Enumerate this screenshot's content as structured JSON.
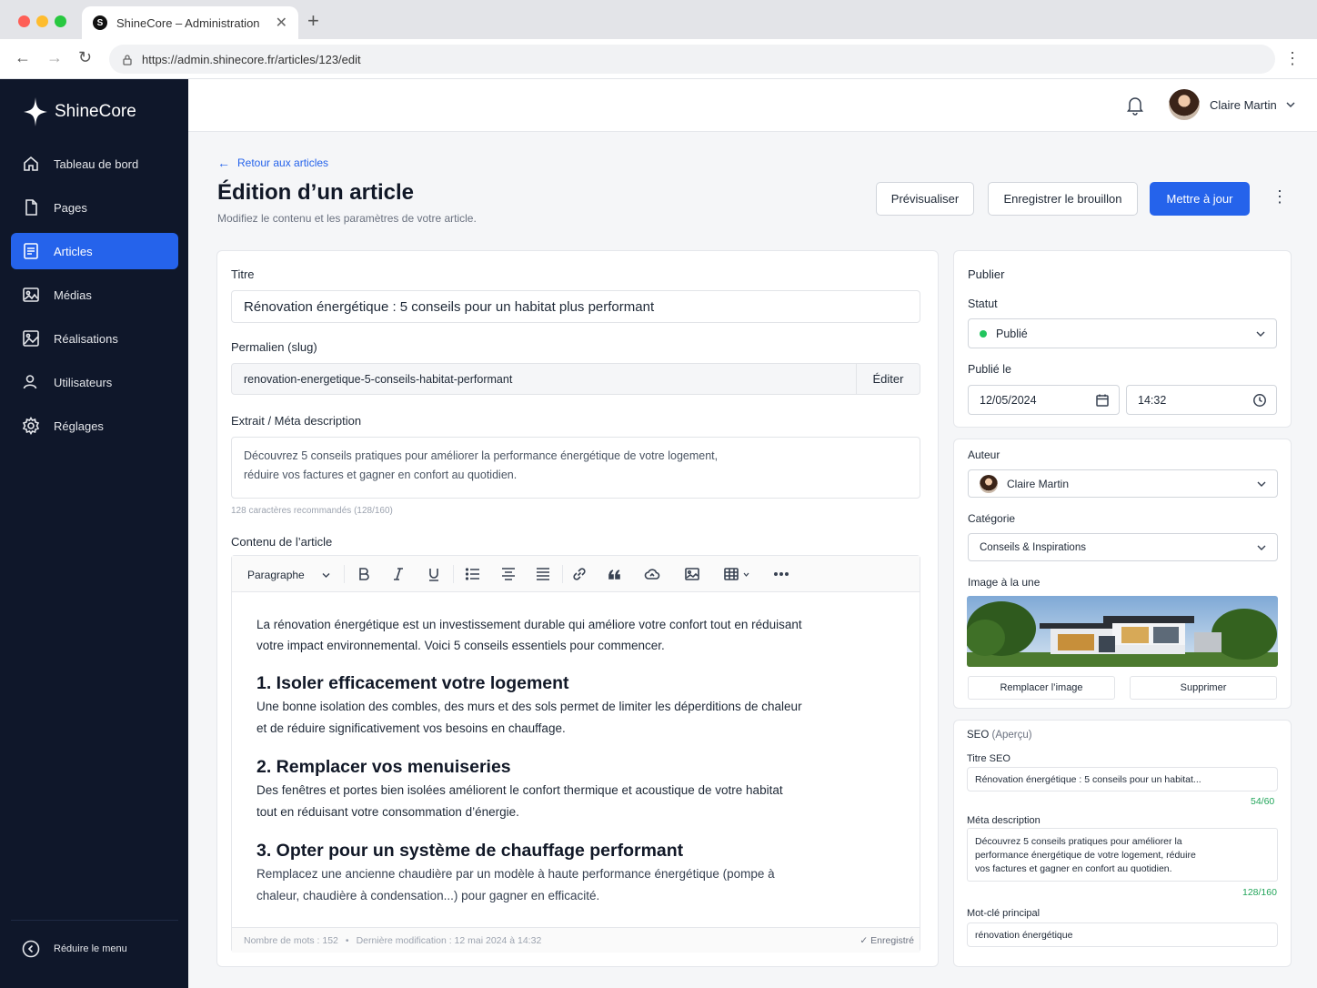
{
  "browser": {
    "tab_title": "ShineCore – Administration",
    "tab_close": "✕",
    "new_tab": "+",
    "url": "https://admin.shinecore.fr/articles/123/edit"
  },
  "sidebar": {
    "brand": "ShineCore",
    "items": [
      {
        "label": "Tableau de bord",
        "icon": "home-icon"
      },
      {
        "label": "Pages",
        "icon": "file-icon"
      },
      {
        "label": "Articles",
        "icon": "article-icon",
        "active": true
      },
      {
        "label": "Médias",
        "icon": "image-icon"
      },
      {
        "label": "Réalisations",
        "icon": "gallery-icon"
      },
      {
        "label": "Utilisateurs",
        "icon": "user-icon"
      },
      {
        "label": "Réglages",
        "icon": "gear-icon"
      }
    ],
    "collapse_label": "Réduire le menu"
  },
  "topbar": {
    "user_name": "Claire Martin"
  },
  "header": {
    "back_label": "Retour aux articles",
    "title": "Édition d’un article",
    "subtitle": "Modifiez le contenu et les paramètres de votre article.",
    "preview_label": "Prévisualiser",
    "draft_label": "Enregistrer le brouillon",
    "update_label": "Mettre à jour"
  },
  "form": {
    "title_label": "Titre",
    "title_value": "Rénovation énergétique : 5 conseils pour un habitat plus performant",
    "slug_label": "Permalien (slug)",
    "slug_value": "renovation-energetique-5-conseils-habitat-performant",
    "slug_edit": "Éditer",
    "excerpt_label": "Extrait / Méta description",
    "excerpt_line1": "Découvrez 5 conseils pratiques pour améliorer la performance énergétique de votre logement,",
    "excerpt_line2": "réduire vos factures et gagner en confort au quotidien.",
    "excerpt_hint": "128 caractères recommandés (128/160)",
    "content_label": "Contenu de l’article"
  },
  "editor": {
    "paragraph_select": "Paragraphe",
    "intro": "La rénovation énergétique est un investissement durable qui améliore votre confort tout en réduisant votre impact environnemental. Voici 5 conseils essentiels pour commencer.",
    "sections": [
      {
        "heading": "1. Isoler efficacement votre logement",
        "text": "Une bonne isolation des combles, des murs et des sols permet de limiter les déperditions de chaleur et de réduire significativement vos besoins en chauffage."
      },
      {
        "heading": "2. Remplacer vos menuiseries",
        "text": "Des fenêtres et portes bien isolées améliorent le confort thermique et acoustique de votre habitat tout en réduisant votre consommation d’énergie."
      },
      {
        "heading": "3. Opter pour un système de chauffage performant",
        "text": "Remplacez une ancienne chaudière par un modèle à haute performance énergétique (pompe à chaleur, chaudière à condensation...) pour gagner en efficacité."
      }
    ],
    "word_count": "Nombre de mots : 152",
    "last_modified": "Dernière modification : 12 mai 2024 à 14:32",
    "saved": "Enregistré"
  },
  "publish": {
    "title": "Publier",
    "status_label": "Statut",
    "status_value": "Publié",
    "published_label": "Publié le",
    "date": "12/05/2024",
    "time": "14:32"
  },
  "meta": {
    "author_label": "Auteur",
    "author_value": "Claire Martin",
    "category_label": "Catégorie",
    "category_value": "Conseils & Inspirations",
    "image_label": "Image à la une",
    "replace_label": "Remplacer l’image",
    "delete_label": "Supprimer"
  },
  "seo": {
    "title": "SEO",
    "title_note": "(Aperçu)",
    "seo_title_label": "Titre SEO",
    "seo_title_value": "Rénovation énergétique : 5 conseils pour un habitat...",
    "seo_title_count": "54/60",
    "meta_label": "Méta description",
    "meta_line1": "Découvrez 5 conseils pratiques pour améliorer la",
    "meta_line2": "performance énergétique de votre logement, réduire",
    "meta_line3": "vos factures et gagner en confort au quotidien.",
    "meta_count": "128/160",
    "keyword_label": "Mot-clé principal",
    "keyword_value": "rénovation énergétique"
  },
  "colors": {
    "accent": "#2563eb",
    "sidebar_bg": "#0f172a",
    "success": "#22c55e"
  }
}
